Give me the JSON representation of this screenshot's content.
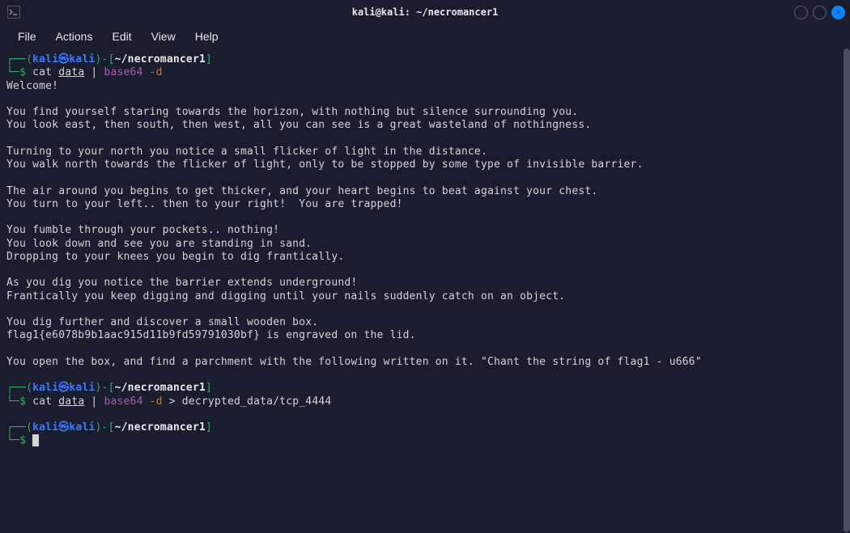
{
  "window": {
    "title": "kali@kali: ~/necromancer1"
  },
  "menubar": {
    "items": [
      "File",
      "Actions",
      "Edit",
      "View",
      "Help"
    ]
  },
  "prompts": [
    {
      "user": "kali",
      "host": "kali",
      "path": "~/necromancer1",
      "command": {
        "parts": [
          {
            "type": "cmd",
            "text": "cat "
          },
          {
            "type": "file",
            "text": "data"
          },
          {
            "type": "cmd",
            "text": " | "
          },
          {
            "type": "base64",
            "text": "base64"
          },
          {
            "type": "cmd",
            "text": " "
          },
          {
            "type": "flag",
            "text": "-d"
          }
        ]
      }
    },
    {
      "user": "kali",
      "host": "kali",
      "path": "~/necromancer1",
      "command": {
        "parts": [
          {
            "type": "cmd",
            "text": "cat "
          },
          {
            "type": "file",
            "text": "data"
          },
          {
            "type": "cmd",
            "text": " | "
          },
          {
            "type": "base64",
            "text": "base64"
          },
          {
            "type": "cmd",
            "text": " "
          },
          {
            "type": "flag",
            "text": "-d"
          },
          {
            "type": "cmd",
            "text": " > decrypted_data/tcp_4444"
          }
        ]
      }
    },
    {
      "user": "kali",
      "host": "kali",
      "path": "~/necromancer1",
      "command": null
    }
  ],
  "output": [
    "Welcome!",
    "",
    "You find yourself staring towards the horizon, with nothing but silence surrounding you.",
    "You look east, then south, then west, all you can see is a great wasteland of nothingness.",
    "",
    "Turning to your north you notice a small flicker of light in the distance.",
    "You walk north towards the flicker of light, only to be stopped by some type of invisible barrier.",
    "",
    "The air around you begins to get thicker, and your heart begins to beat against your chest.",
    "You turn to your left.. then to your right!  You are trapped!",
    "",
    "You fumble through your pockets.. nothing!",
    "You look down and see you are standing in sand.",
    "Dropping to your knees you begin to dig frantically.",
    "",
    "As you dig you notice the barrier extends underground!",
    "Frantically you keep digging and digging until your nails suddenly catch on an object.",
    "",
    "You dig further and discover a small wooden box.",
    "flag1{e6078b9b1aac915d11b9fd59791030bf} is engraved on the lid.",
    "",
    "You open the box, and find a parchment with the following written on it. \"Chant the string of flag1 - u666\""
  ]
}
